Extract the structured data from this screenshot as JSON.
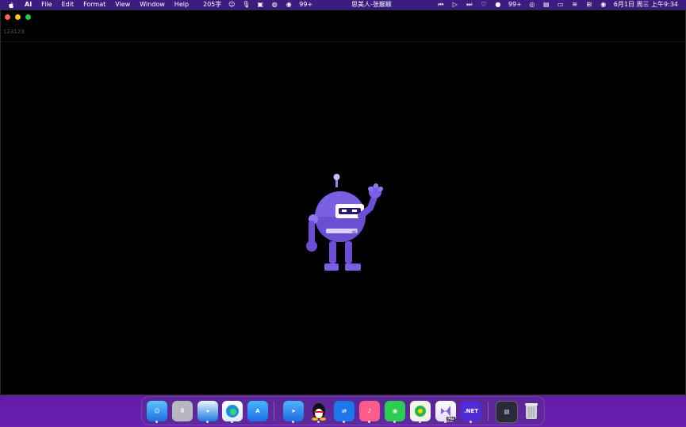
{
  "menubar": {
    "app": "AI",
    "menus": [
      "File",
      "Edit",
      "Format",
      "View",
      "Window",
      "Help"
    ],
    "word_count": "205字",
    "now_playing": "思美人-张靓颖",
    "badge_left": "99+",
    "badge_right": "99+",
    "datetime": "6月1日 周三 上午9:34"
  },
  "window": {
    "doc_text": "123123"
  },
  "dock": {
    "dotnet_label": ".NET",
    "vs_label": "PRE"
  }
}
